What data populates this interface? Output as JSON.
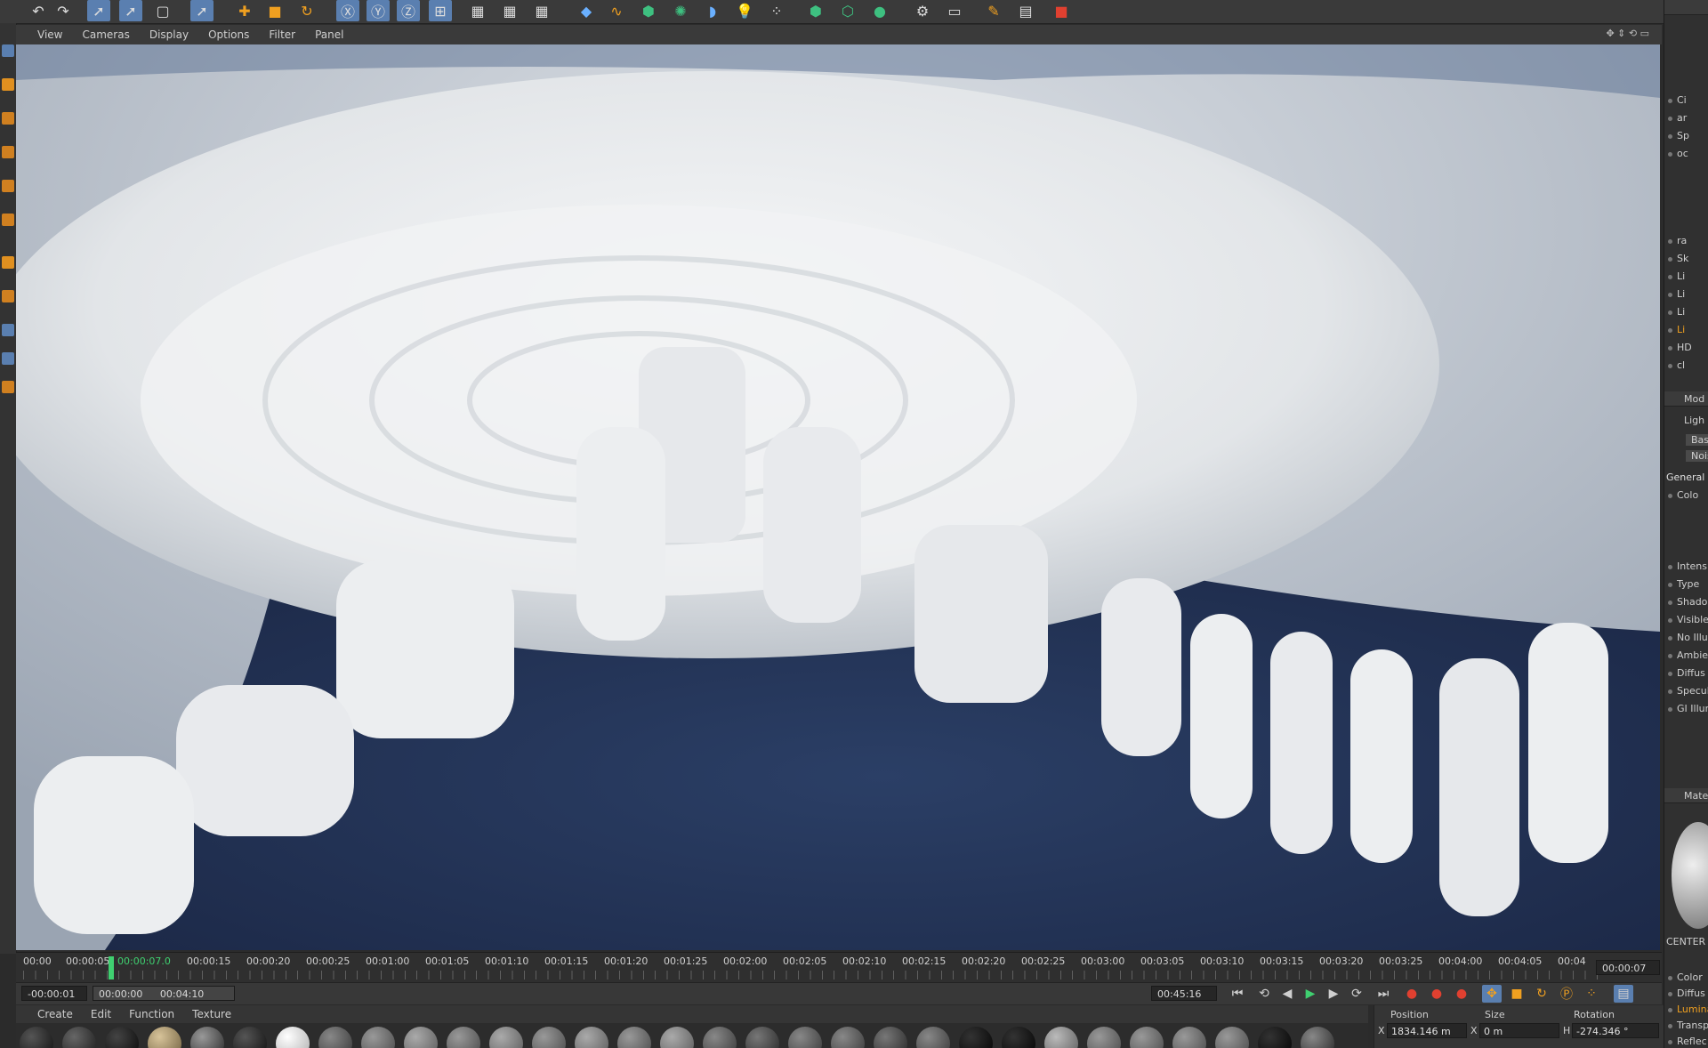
{
  "toolbar": {
    "icons": [
      "undo-icon",
      "redo-icon",
      "live-selection-icon",
      "move-select-icon",
      "rect-select-icon",
      "move-icon",
      "add-icon",
      "scale-icon",
      "rotate-icon",
      "x-axis-icon",
      "y-axis-icon",
      "z-axis-icon",
      "coordinate-system-icon",
      "render-view-icon",
      "render-picture-viewer-icon",
      "render-settings-icon",
      "cube-icon",
      "spline-icon",
      "nurbs-icon",
      "array-icon",
      "deformer-icon",
      "light-icon",
      "particles-icon",
      "scene-icon",
      "camera-icon",
      "material-sphere-icon",
      "settings-icon",
      "grid-icon",
      "pen-icon",
      "brush-icon",
      "stop-icon"
    ]
  },
  "viewport_menu": {
    "items": [
      "View",
      "Cameras",
      "Display",
      "Options",
      "Filter",
      "Panel"
    ]
  },
  "timeline": {
    "ticks": [
      "00:00",
      "00:00:05",
      "00:00:07.0",
      "00:00:15",
      "00:00:20",
      "00:00:25",
      "00:01:00",
      "00:01:05",
      "00:01:10",
      "00:01:15",
      "00:01:20",
      "00:01:25",
      "00:02:00",
      "00:02:05",
      "00:02:10",
      "00:02:15",
      "00:02:20",
      "00:02:25",
      "00:03:00",
      "00:03:05",
      "00:03:10",
      "00:03:15",
      "00:03:20",
      "00:03:25",
      "00:04:00",
      "00:04:05",
      "00:04"
    ],
    "current_frame": "00:00:07"
  },
  "transport": {
    "start_field": "-00:00:01",
    "range_start": "00:00:00",
    "range_end": "00:04:10",
    "end_field": "00:45:16"
  },
  "material_menu": {
    "items": [
      "Create",
      "Edit",
      "Function",
      "Texture"
    ]
  },
  "coordinates": {
    "position_label": "Position",
    "size_label": "Size",
    "rotation_label": "Rotation",
    "x_axis": "X",
    "position_x": "1834.146 m",
    "size_x_axis": "X",
    "size_x": "0 m",
    "rotation_axis": "H",
    "rotation_h": "-274.346 °"
  },
  "right_panel": {
    "object_items": [
      "Ci",
      "ar",
      "Sp",
      "oc",
      "ra",
      "Sk",
      "Li",
      "Li",
      "Li",
      "Li",
      "HD",
      "cl"
    ],
    "mode_label": "Mod",
    "light_label": "Ligh",
    "tab_basic": "Basic",
    "tab_noise": "Noise",
    "general_label": "General",
    "color_label": "Colo",
    "attributes": [
      "Intens",
      "Type",
      "Shado",
      "Visible",
      "No Illu",
      "Ambie",
      "Diffus",
      "Specul",
      "GI Illur"
    ],
    "material_header": "Mate",
    "center_label": "CENTER",
    "channels": [
      "Color",
      "Diffus",
      "Lumina",
      "Transp",
      "Reflec"
    ]
  },
  "colors": {
    "accent_blue": "#5a7fb0",
    "playhead_green": "#3fd070",
    "icon_orange": "#f0a020",
    "ocean_blue": "#223457",
    "cloud_white": "#eceef0"
  }
}
